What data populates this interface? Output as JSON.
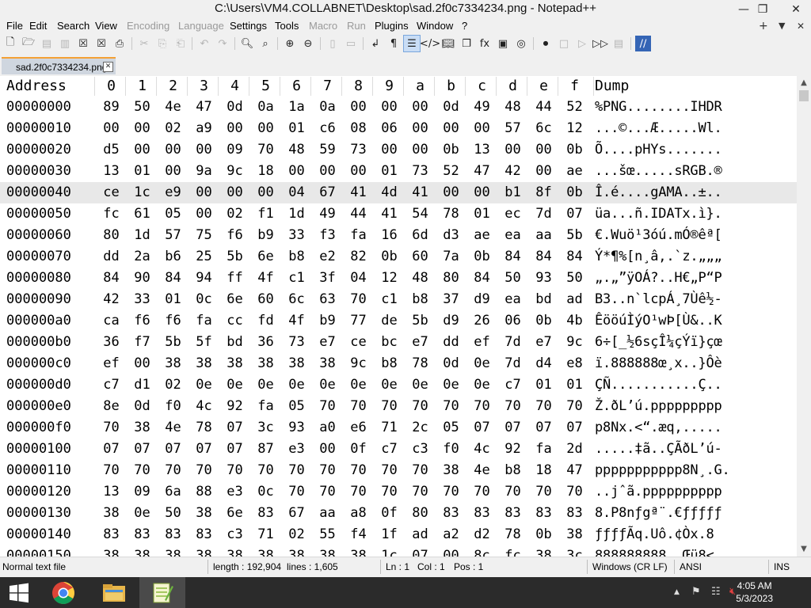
{
  "window": {
    "title": "C:\\Users\\VM4.COLLABNET\\Desktop\\sad.2f0c7334234.png - Notepad++",
    "minimize": "—",
    "restore": "❐",
    "close": "✕"
  },
  "menu": {
    "items": [
      "File",
      "Edit",
      "Search",
      "View",
      "Encoding",
      "Language",
      "Settings",
      "Tools",
      "Macro",
      "Run",
      "Plugins",
      "Window",
      "?"
    ],
    "right": [
      "+",
      "▼",
      "✕"
    ]
  },
  "tab": {
    "label": "sad.2f0c7334234.png",
    "close": "✕"
  },
  "hex": {
    "header": [
      "Address",
      "0",
      "1",
      "2",
      "3",
      "4",
      "5",
      "6",
      "7",
      "8",
      "9",
      "a",
      "b",
      "c",
      "d",
      "e",
      "f",
      "Dump"
    ],
    "rows": [
      {
        "addr": "00000000",
        "bytes": [
          "89",
          "50",
          "4e",
          "47",
          "0d",
          "0a",
          "1a",
          "0a",
          "00",
          "00",
          "00",
          "0d",
          "49",
          "48",
          "44",
          "52"
        ],
        "dump": "%PNG........IHDR"
      },
      {
        "addr": "00000010",
        "bytes": [
          "00",
          "00",
          "02",
          "a9",
          "00",
          "00",
          "01",
          "c6",
          "08",
          "06",
          "00",
          "00",
          "00",
          "57",
          "6c",
          "12"
        ],
        "dump": "...©...Æ.....Wl."
      },
      {
        "addr": "00000020",
        "bytes": [
          "d5",
          "00",
          "00",
          "00",
          "09",
          "70",
          "48",
          "59",
          "73",
          "00",
          "00",
          "0b",
          "13",
          "00",
          "00",
          "0b"
        ],
        "dump": "Õ....pHYs......."
      },
      {
        "addr": "00000030",
        "bytes": [
          "13",
          "01",
          "00",
          "9a",
          "9c",
          "18",
          "00",
          "00",
          "00",
          "01",
          "73",
          "52",
          "47",
          "42",
          "00",
          "ae"
        ],
        "dump": "...šœ.....sRGB.®"
      },
      {
        "addr": "00000040",
        "bytes": [
          "ce",
          "1c",
          "e9",
          "00",
          "00",
          "00",
          "04",
          "67",
          "41",
          "4d",
          "41",
          "00",
          "00",
          "b1",
          "8f",
          "0b"
        ],
        "dump": "Î.é....gAMA..±.."
      },
      {
        "addr": "00000050",
        "bytes": [
          "fc",
          "61",
          "05",
          "00",
          "02",
          "f1",
          "1d",
          "49",
          "44",
          "41",
          "54",
          "78",
          "01",
          "ec",
          "7d",
          "07"
        ],
        "dump": "üa...ñ.IDATx.ì}."
      },
      {
        "addr": "00000060",
        "bytes": [
          "80",
          "1d",
          "57",
          "75",
          "f6",
          "b9",
          "33",
          "f3",
          "fa",
          "16",
          "6d",
          "d3",
          "ae",
          "ea",
          "aa",
          "5b"
        ],
        "dump": "€.Wuö¹3óú.mÓ®êª["
      },
      {
        "addr": "00000070",
        "bytes": [
          "dd",
          "2a",
          "b6",
          "25",
          "5b",
          "6e",
          "b8",
          "e2",
          "82",
          "0b",
          "60",
          "7a",
          "0b",
          "84",
          "84",
          "84"
        ],
        "dump": "Ý*¶%[n¸â‚.`z.„„„"
      },
      {
        "addr": "00000080",
        "bytes": [
          "84",
          "90",
          "84",
          "94",
          "ff",
          "4f",
          "c1",
          "3f",
          "04",
          "12",
          "48",
          "80",
          "84",
          "50",
          "93",
          "50"
        ],
        "dump": "„.„”ÿOÁ?..H€„P“P"
      },
      {
        "addr": "00000090",
        "bytes": [
          "42",
          "33",
          "01",
          "0c",
          "6e",
          "60",
          "6c",
          "63",
          "70",
          "c1",
          "b8",
          "37",
          "d9",
          "ea",
          "bd",
          "ad"
        ],
        "dump": "B3..n`lcpÁ¸7Ùê½-"
      },
      {
        "addr": "000000a0",
        "bytes": [
          "ca",
          "f6",
          "f6",
          "fa",
          "cc",
          "fd",
          "4f",
          "b9",
          "77",
          "de",
          "5b",
          "d9",
          "26",
          "06",
          "0b",
          "4b"
        ],
        "dump": "ÊööúÌýO¹wÞ[Ù&..K"
      },
      {
        "addr": "000000b0",
        "bytes": [
          "36",
          "f7",
          "5b",
          "5f",
          "bd",
          "36",
          "73",
          "e7",
          "ce",
          "bc",
          "e7",
          "dd",
          "ef",
          "7d",
          "e7",
          "9c"
        ],
        "dump": "6÷[_½6sçÎ¼çÝï}çœ"
      },
      {
        "addr": "000000c0",
        "bytes": [
          "ef",
          "00",
          "38",
          "38",
          "38",
          "38",
          "38",
          "38",
          "9c",
          "b8",
          "78",
          "0d",
          "0e",
          "7d",
          "d4",
          "e8"
        ],
        "dump": "ï.888888œ¸x..}Ôè"
      },
      {
        "addr": "000000d0",
        "bytes": [
          "c7",
          "d1",
          "02",
          "0e",
          "0e",
          "0e",
          "0e",
          "0e",
          "0e",
          "0e",
          "0e",
          "0e",
          "0e",
          "c7",
          "01",
          "01"
        ],
        "dump": "ÇÑ...........Ç.."
      },
      {
        "addr": "000000e0",
        "bytes": [
          "8e",
          "0d",
          "f0",
          "4c",
          "92",
          "fa",
          "05",
          "70",
          "70",
          "70",
          "70",
          "70",
          "70",
          "70",
          "70",
          "70"
        ],
        "dump": "Ž.ðL’ú.ppppppppp"
      },
      {
        "addr": "000000f0",
        "bytes": [
          "70",
          "38",
          "4e",
          "78",
          "07",
          "3c",
          "93",
          "a0",
          "e6",
          "71",
          "2c",
          "05",
          "07",
          "07",
          "07",
          "07"
        ],
        "dump": "p8Nx.<“.æq,....."
      },
      {
        "addr": "00000100",
        "bytes": [
          "07",
          "07",
          "07",
          "07",
          "07",
          "87",
          "e3",
          "00",
          "0f",
          "c7",
          "c3",
          "f0",
          "4c",
          "92",
          "fa",
          "2d"
        ],
        "dump": ".....‡ã..ÇÃðL’ú-"
      },
      {
        "addr": "00000110",
        "bytes": [
          "70",
          "70",
          "70",
          "70",
          "70",
          "70",
          "70",
          "70",
          "70",
          "70",
          "70",
          "38",
          "4e",
          "b8",
          "18",
          "47",
          "04"
        ],
        "dump": "ppppppppppp8N¸.G."
      },
      {
        "addr": "00000120",
        "bytes": [
          "13",
          "09",
          "6a",
          "88",
          "e3",
          "0c",
          "70",
          "70",
          "70",
          "70",
          "70",
          "70",
          "70",
          "70",
          "70",
          "70"
        ],
        "dump": "..jˆã.pppppppppp"
      },
      {
        "addr": "00000130",
        "bytes": [
          "38",
          "0e",
          "50",
          "38",
          "6e",
          "83",
          "67",
          "aa",
          "a8",
          "0f",
          "80",
          "83",
          "83",
          "83",
          "83",
          "83"
        ],
        "dump": "8.P8nƒgª¨.€ƒƒƒƒƒ"
      },
      {
        "addr": "00000140",
        "bytes": [
          "83",
          "83",
          "83",
          "83",
          "c3",
          "71",
          "02",
          "55",
          "f4",
          "1f",
          "ad",
          "a2",
          "d2",
          "78",
          "0b",
          "38"
        ],
        "dump": "ƒƒƒƒÃq.Uô.­¢Òx.8"
      },
      {
        "addr": "00000150",
        "bytes": [
          "38",
          "38",
          "38",
          "38",
          "38",
          "38",
          "38",
          "38",
          "38",
          "1c",
          "07",
          "00",
          "8c",
          "fc",
          "38",
          "3c"
        ],
        "dump": "888888888..Œü8<"
      }
    ]
  },
  "status": {
    "mode": "Normal text file",
    "length": "length : 192,904",
    "lines": "lines : 1,605",
    "ln": "Ln : 1",
    "col": "Col : 1",
    "pos": "Pos : 1",
    "eol": "Windows (CR LF)",
    "encoding": "ANSI",
    "ins": "INS"
  },
  "taskbar": {
    "time": "4:05 AM",
    "date": "5/3/2023"
  },
  "colors": {
    "tab_accent": "#f4a035",
    "highlight_row": "#e8e8e8",
    "taskbar": "#2b2b2b"
  }
}
